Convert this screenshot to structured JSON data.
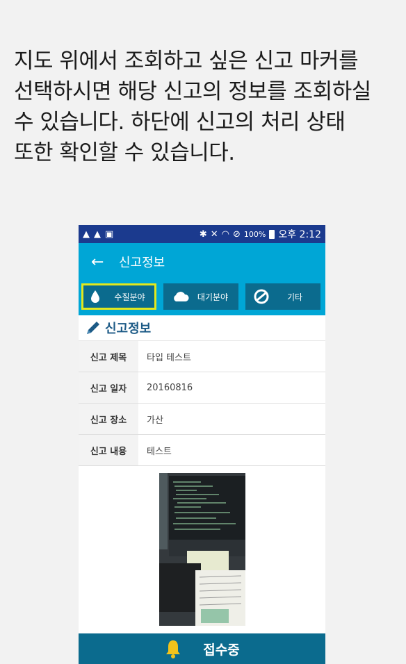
{
  "instruction": {
    "line1": "지도 위에서 조회하고 싶은 신고 마커를",
    "line2": "선택하시면 해당 신고의 정보를 조회하실",
    "line3": "수 있습니다. 하단에 신고의 처리 상태",
    "line4": "또한 확인할 수 있습니다."
  },
  "status_bar": {
    "battery": "100%",
    "time": "오후 2:12"
  },
  "app_bar": {
    "title": "신고정보"
  },
  "tabs": [
    {
      "label": "수질분야",
      "icon": "water-drop-icon",
      "selected": true
    },
    {
      "label": "대기분야",
      "icon": "cloud-icon",
      "selected": false
    },
    {
      "label": "기타",
      "icon": "no-entry-icon",
      "selected": false
    }
  ],
  "section": {
    "title": "신고정보"
  },
  "report": [
    {
      "label": "신고 제목",
      "value": "타입 테스트"
    },
    {
      "label": "신고 일자",
      "value": "20160816"
    },
    {
      "label": "신고 장소",
      "value": "가산"
    },
    {
      "label": "신고 내용",
      "value": "테스트"
    }
  ],
  "footer": {
    "status": "접수중",
    "icon": "bell-icon"
  },
  "colors": {
    "status_bar": "#1b3a8e",
    "primary": "#00a6d6",
    "tab_bg": "#0b6b8e",
    "selected_border": "#e3e81c",
    "section_title": "#1c5a86"
  }
}
